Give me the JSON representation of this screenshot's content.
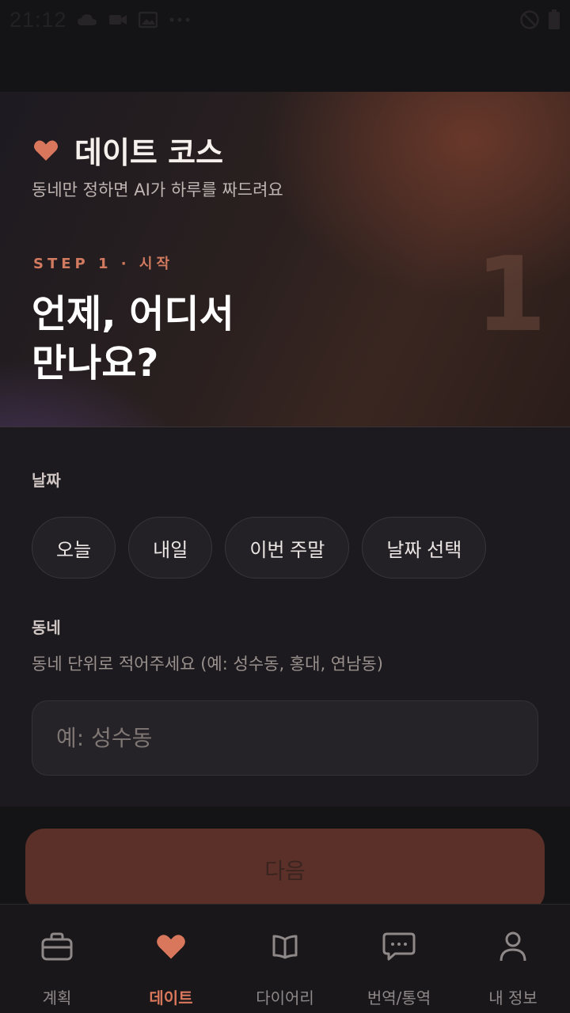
{
  "status_bar": {
    "time": "21:12"
  },
  "hero": {
    "title": "데이트 코스",
    "subtitle": "동네만 정하면 AI가 하루를 짜드려요",
    "step_label": "STEP 1 · 시작",
    "step_number": "1",
    "question_line1": "언제, 어디서",
    "question_line2": "만나요?"
  },
  "form": {
    "date_label": "날짜",
    "date_options": [
      "오늘",
      "내일",
      "이번 주말",
      "날짜 선택"
    ],
    "neighborhood_label": "동네",
    "neighborhood_helper": "동네 단위로 적어주세요 (예: 성수동, 홍대, 연남동)",
    "neighborhood_placeholder": "예: 성수동",
    "neighborhood_value": ""
  },
  "next_button_label": "다음",
  "nav": {
    "items": [
      {
        "label": "계획",
        "icon": "briefcase-icon"
      },
      {
        "label": "데이트",
        "icon": "heart-icon",
        "active": true
      },
      {
        "label": "다이어리",
        "icon": "book-icon"
      },
      {
        "label": "번역/통역",
        "icon": "chat-bubble-icon"
      },
      {
        "label": "내 정보",
        "icon": "person-icon"
      }
    ]
  },
  "colors": {
    "accent": "#d9775c",
    "background": "#1a181c",
    "button_disabled": "#5a3028"
  }
}
